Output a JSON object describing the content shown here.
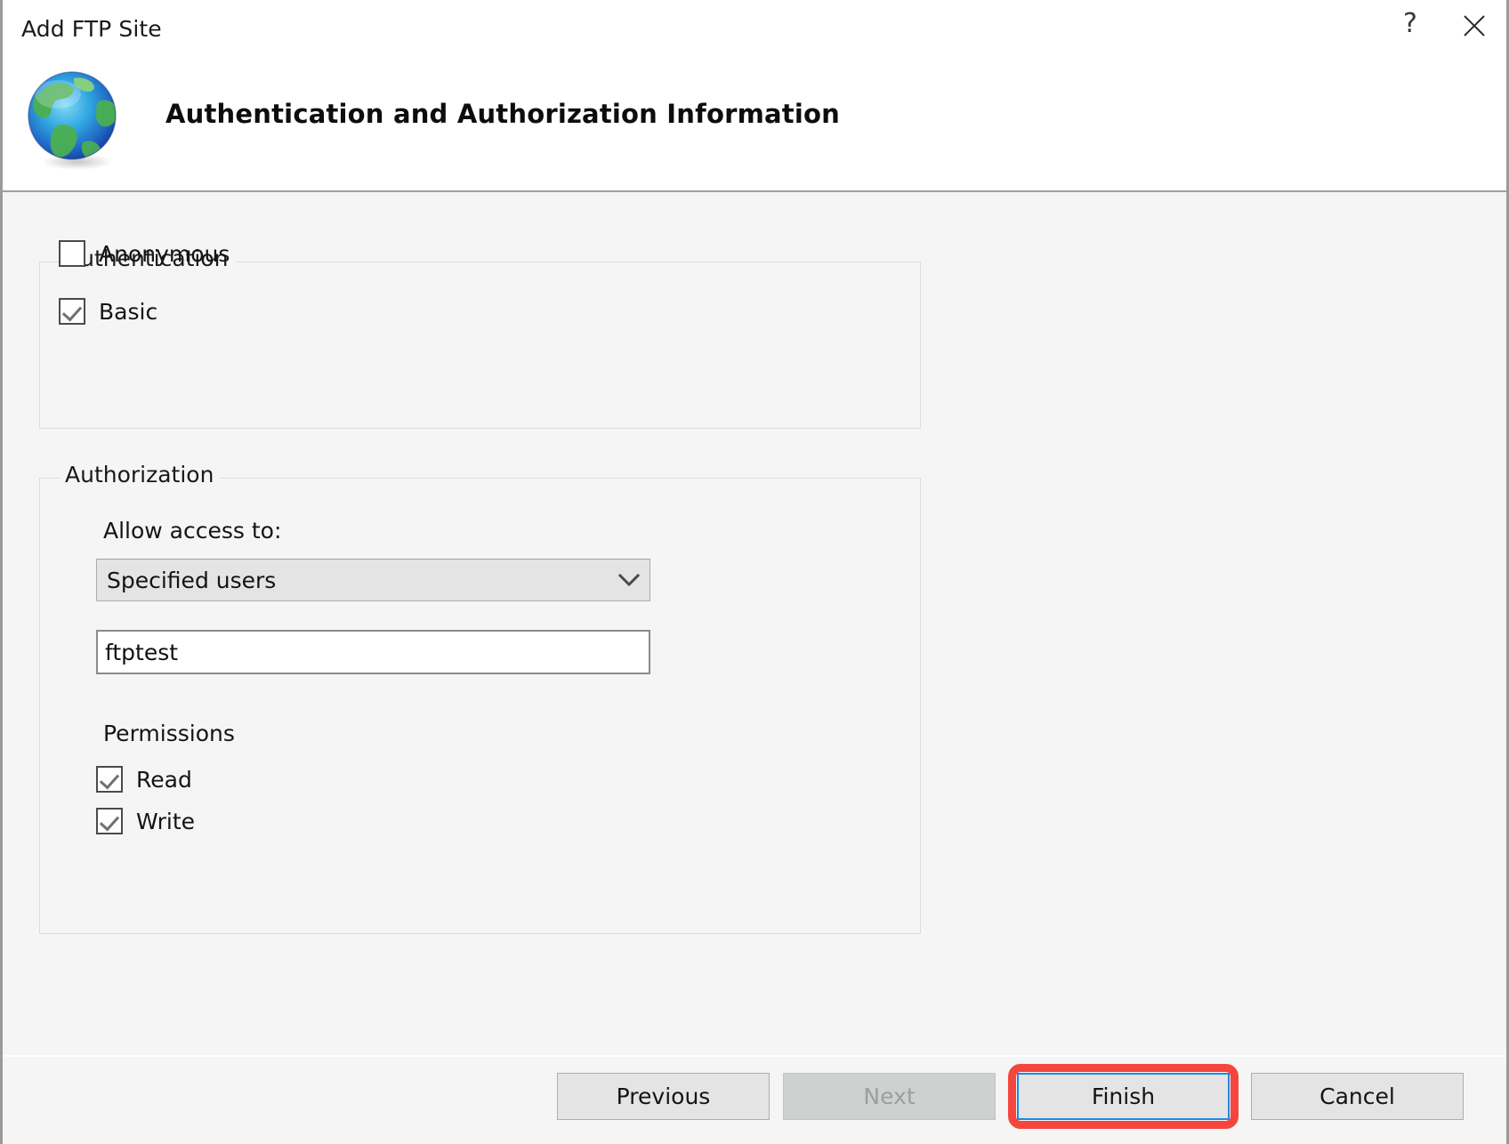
{
  "window": {
    "title": "Add FTP Site",
    "help_icon": "question-mark-icon",
    "close_icon": "close-icon"
  },
  "header": {
    "icon": "globe-icon",
    "title": "Authentication and Authorization Information"
  },
  "authentication": {
    "legend": "Authentication",
    "options": [
      {
        "label": "Anonymous",
        "checked": false
      },
      {
        "label": "Basic",
        "checked": true
      }
    ]
  },
  "authorization": {
    "legend": "Authorization",
    "allow_access_label": "Allow access to:",
    "allow_access_value": "Specified users",
    "allow_access_arrow_icon": "chevron-down-icon",
    "users_value": "ftptest",
    "users_placeholder": "",
    "permissions_label": "Permissions",
    "permissions": [
      {
        "label": "Read",
        "checked": true
      },
      {
        "label": "Write",
        "checked": true
      }
    ]
  },
  "footer": {
    "previous_label": "Previous",
    "next_label": "Next",
    "finish_label": "Finish",
    "cancel_label": "Cancel"
  },
  "colors": {
    "highlight_red": "#F4463D",
    "focus_blue": "#1E88E5",
    "dialog_background": "#F5F5F5",
    "header_background": "#FFFFFF",
    "button_face": "#E4E4E4",
    "button_disabled": "#CDD1D0"
  }
}
